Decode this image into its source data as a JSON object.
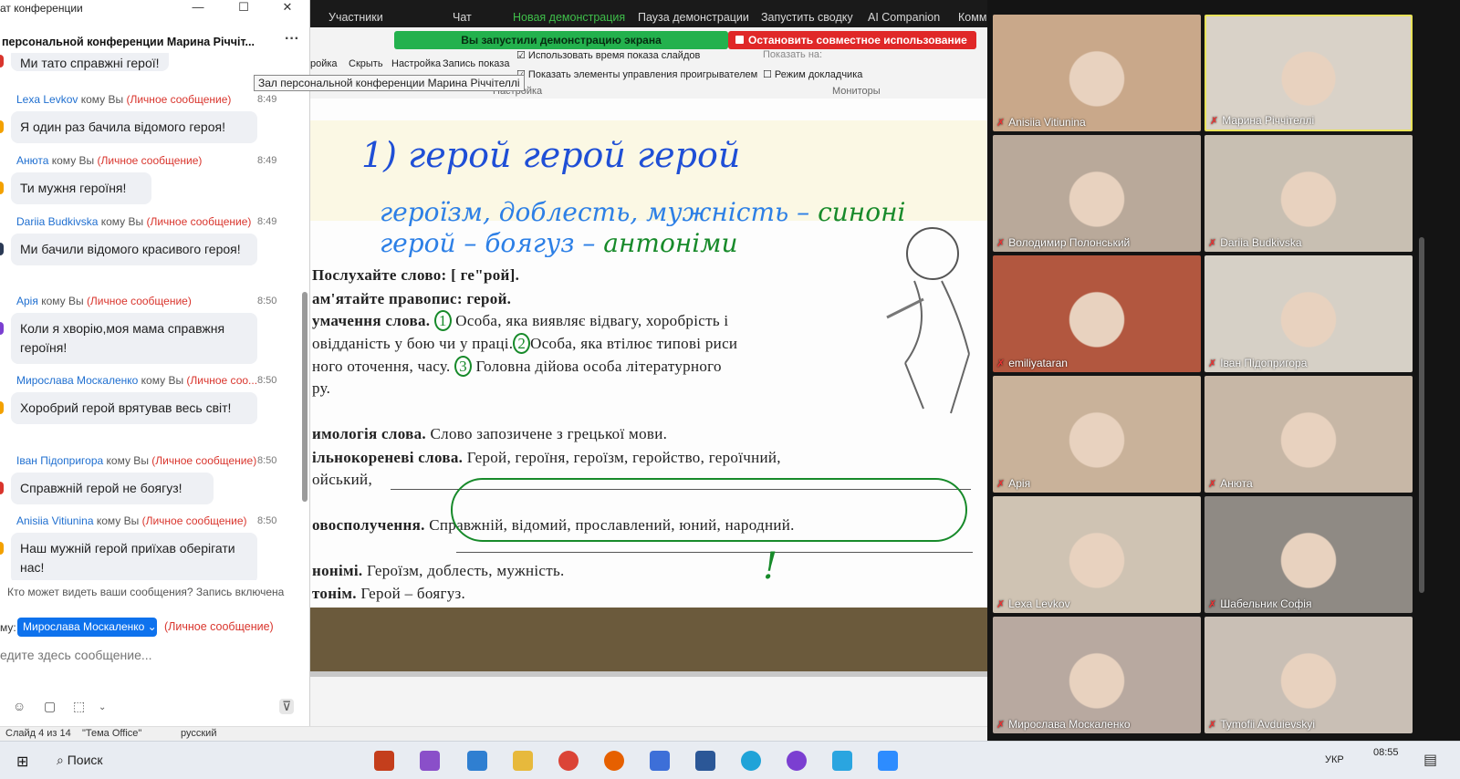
{
  "chat": {
    "window_title": "ат конференции",
    "conference_title": "персональной конференции Марина Річчіт...",
    "more": "···",
    "tooltip": "Зал персональной конференции Марина Річчітеллі",
    "partial_first_message": "Ми тато справжні герої!",
    "messages": [
      {
        "sender": "Lexa Levkov",
        "to": "кому Вы",
        "priv": "(Личное сообщение)",
        "time": "8:49",
        "text": "Я один раз бачила відомого героя!",
        "dot": "#f3a100"
      },
      {
        "sender": "Анюта",
        "to": "кому Вы",
        "priv": "(Личное сообщение)",
        "time": "8:49",
        "text": "Ти мужня героїня!",
        "dot": "#f3a100"
      },
      {
        "sender": "Dariia Budkivska",
        "to": "кому Вы",
        "priv": "(Личное сообщение)",
        "time": "8:49",
        "text": "Ми бачили відомого красивого героя!",
        "dot": "#2b3a55"
      },
      {
        "sender": "Арія",
        "to": "кому Вы",
        "priv": "(Личное сообщение)",
        "time": "8:50",
        "text": "Коли я хворію,моя мама справжня героїня!",
        "dot": "#7b3fd1"
      },
      {
        "sender": "Мирослава Москаленко",
        "to": "кому Вы",
        "priv": "(Личное соо...",
        "time": "8:50",
        "text": "Хоробрий герой врятував весь світ!",
        "dot": "#f3a100"
      },
      {
        "sender": "Іван Підопригора",
        "to": "кому Вы",
        "priv": "(Личное сообщение)",
        "time": "8:50",
        "text": "Справжній герой не боягуз!",
        "dot": "#d9352d"
      },
      {
        "sender": "Anisiia Vitiunina",
        "to": "кому Вы",
        "priv": "(Личное сообщение)",
        "time": "8:50",
        "text": "Наш мужній герой приїхав оберігати нас!",
        "dot": "#f3a100"
      }
    ],
    "who_can_see": "Кто может видеть ваши сообщения? Запись включена",
    "to_label": "му:",
    "recipient": "Мирослава Москаленко ⌄",
    "recipient_priv": "(Личное сообщение)",
    "input_placeholder": "едите здесь сообщение..."
  },
  "zoom_toolbar": {
    "items": [
      "Участники",
      "Чат",
      "Новая демонстрация",
      "Пауза демонстрации",
      "Запустить сводку",
      "AI Companion",
      "Комм"
    ],
    "sharing_status": "Вы запустили демонстрацию экрана",
    "stop_share": "Остановить совместное использование"
  },
  "ribbon": {
    "items": [
      "ройка",
      "Скрыть",
      "Настройка",
      "Запись показа",
      "Использовать время показа слайдов",
      "Показать элементы управления проигрывателем",
      "Режим докладчика",
      "Показать на:",
      "Настройка",
      "Мониторы"
    ]
  },
  "slide": {
    "hw_line1": "1) герой   герой   герой",
    "hw_line2": "героїзм, доблесть, мужність –",
    "hw_line2_green": "синоні",
    "hw_line3": "герой – боягуз –",
    "hw_line3_green": "антоніми",
    "hw_exclaim": "!",
    "listen_label": "Послухайте слово:",
    "listen_value": "[ ге\"рой].",
    "remember_label": "ам'ятайте правопис:",
    "remember_value": "герой.",
    "meaning_label": "умачення слова.",
    "meaning_1": "Особа, яка виявляє відвагу, хоробрість і",
    "meaning_2": "овідданість у бою чи у праці.",
    "meaning_2b": "Особа, яка втілює типові риси",
    "meaning_3": "ного оточення, часу.",
    "meaning_3b": "Головна дійова особа літературного",
    "meaning_4": "ру.",
    "etym_label": "имологія слова.",
    "etym_value": "Слово запозичене з грецької мови.",
    "cognates_label": "ільнокореневі слова.",
    "cognates_value": "Герой, героїня, героїзм, геройство, героїчний,",
    "cognates_2": "ойський,",
    "colloc_label": "овосполучення.",
    "colloc_value": "Справжній, відомий, прославлений, юний, народний.",
    "syn_label": "нонімі.",
    "syn_value": "Героїзм, доблесть, мужність.",
    "ant_label": "тонім.",
    "ant_value": "Герой – боягуз."
  },
  "participants": [
    {
      "name": "Anisiia Vitiunina",
      "bg": "#c9a88a"
    },
    {
      "name": "Марина Річчітеллі",
      "bg": "#d9d2c8"
    },
    {
      "name": "Володимир Полонський",
      "bg": "#b9a99a"
    },
    {
      "name": "Dariia Budkivska",
      "bg": "#c8bfb2"
    },
    {
      "name": "emiliyataran",
      "bg": "#b2573f"
    },
    {
      "name": "Іван Підопригора",
      "bg": "#d6d0c6"
    },
    {
      "name": "Арія",
      "bg": "#c9b29a"
    },
    {
      "name": "Анюта",
      "bg": "#c7b7a6"
    },
    {
      "name": "Lexa Levkov",
      "bg": "#cfc3b3"
    },
    {
      "name": "Шабельник Софія",
      "bg": "#8f8a84"
    },
    {
      "name": "Мирослава Москаленко",
      "bg": "#b8a9a0"
    },
    {
      "name": "Tymofii Avduievskyi",
      "bg": "#c9bfb5"
    }
  ],
  "statusbar": {
    "slide": "Слайд 4 из 14",
    "theme": "\"Тема Office\"",
    "lang": "русский"
  },
  "taskbar": {
    "search": "Поиск",
    "lang": "УКР",
    "time": "08:55"
  }
}
